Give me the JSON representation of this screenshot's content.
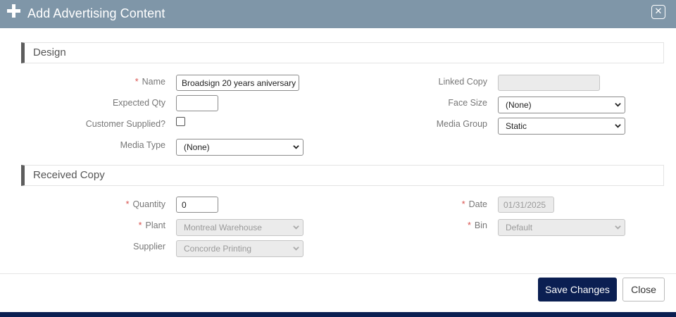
{
  "dialog": {
    "title": "Add Advertising Content",
    "close_icon": "close-icon"
  },
  "colors": {
    "titlebar": "#7f96a8",
    "primary": "#0b1f52",
    "required": "#d9534f"
  },
  "design": {
    "section_title": "Design",
    "name": {
      "label": "Name",
      "required": "*",
      "value": "Broadsign 20 years aniversary"
    },
    "expected_qty": {
      "label": "Expected Qty",
      "value": ""
    },
    "customer_supplied": {
      "label": "Customer Supplied?",
      "checked": false
    },
    "media_type": {
      "label": "Media Type",
      "value": "(None)"
    },
    "linked_copy": {
      "label": "Linked Copy",
      "value": ""
    },
    "face_size": {
      "label": "Face Size",
      "value": "(None)"
    },
    "media_group": {
      "label": "Media Group",
      "value": "Static"
    }
  },
  "received": {
    "section_title": "Received Copy",
    "quantity": {
      "label": "Quantity",
      "required": "*",
      "value": "0"
    },
    "plant": {
      "label": "Plant",
      "required": "*",
      "value": "Montreal Warehouse"
    },
    "supplier": {
      "label": "Supplier",
      "value": "Concorde Printing"
    },
    "date": {
      "label": "Date",
      "required": "*",
      "value": "01/31/2025"
    },
    "bin": {
      "label": "Bin",
      "required": "*",
      "value": "Default"
    }
  },
  "footer": {
    "save_label": "Save Changes",
    "close_label": "Close"
  }
}
